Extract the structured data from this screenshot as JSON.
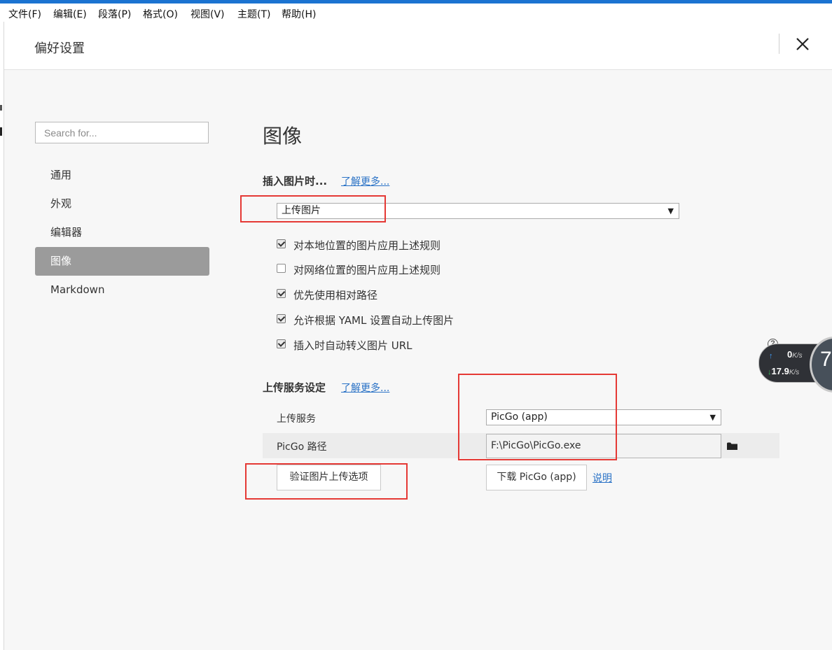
{
  "menubar": {
    "items": [
      "文件(F)",
      "编辑(E)",
      "段落(P)",
      "格式(O)",
      "视图(V)",
      "主题(T)",
      "帮助(H)"
    ]
  },
  "dialog": {
    "title": "偏好设置"
  },
  "sidebar": {
    "search_placeholder": "Search for...",
    "items": [
      {
        "label": "通用"
      },
      {
        "label": "外观"
      },
      {
        "label": "编辑器"
      },
      {
        "label": "图像",
        "active": true
      },
      {
        "label": "Markdown"
      }
    ]
  },
  "main": {
    "title": "图像",
    "insert": {
      "label": "插入图片时...",
      "more_link": "了解更多...",
      "select_value": "上传图片",
      "options": [
        {
          "label": "对本地位置的图片应用上述规则",
          "checked": true
        },
        {
          "label": "对网络位置的图片应用上述规则",
          "checked": false
        },
        {
          "label": "优先使用相对路径",
          "checked": true
        },
        {
          "label": "允许根据 YAML 设置自动上传图片",
          "checked": true
        },
        {
          "label": "插入时自动转义图片 URL",
          "checked": true
        }
      ]
    },
    "upload": {
      "label": "上传服务设定",
      "more_link": "了解更多...",
      "service_label": "上传服务",
      "service_value": "PicGo (app)",
      "path_label": "PicGo 路径",
      "path_value": "F:\\PicGo\\PicGo.exe",
      "verify_button": "验证图片上传选项",
      "download_button": "下载 PicGo (app)",
      "help_link": "说明"
    }
  },
  "speed_widget": {
    "upload_value": "0",
    "upload_unit": "K/s",
    "download_value": "17.9",
    "download_unit": "K/s",
    "digit": "7"
  },
  "colors": {
    "accent": "#2a72c6",
    "active_nav": "#9b9b9b",
    "annotation_red": "#e53935",
    "title_bar": "#1b73d1"
  }
}
